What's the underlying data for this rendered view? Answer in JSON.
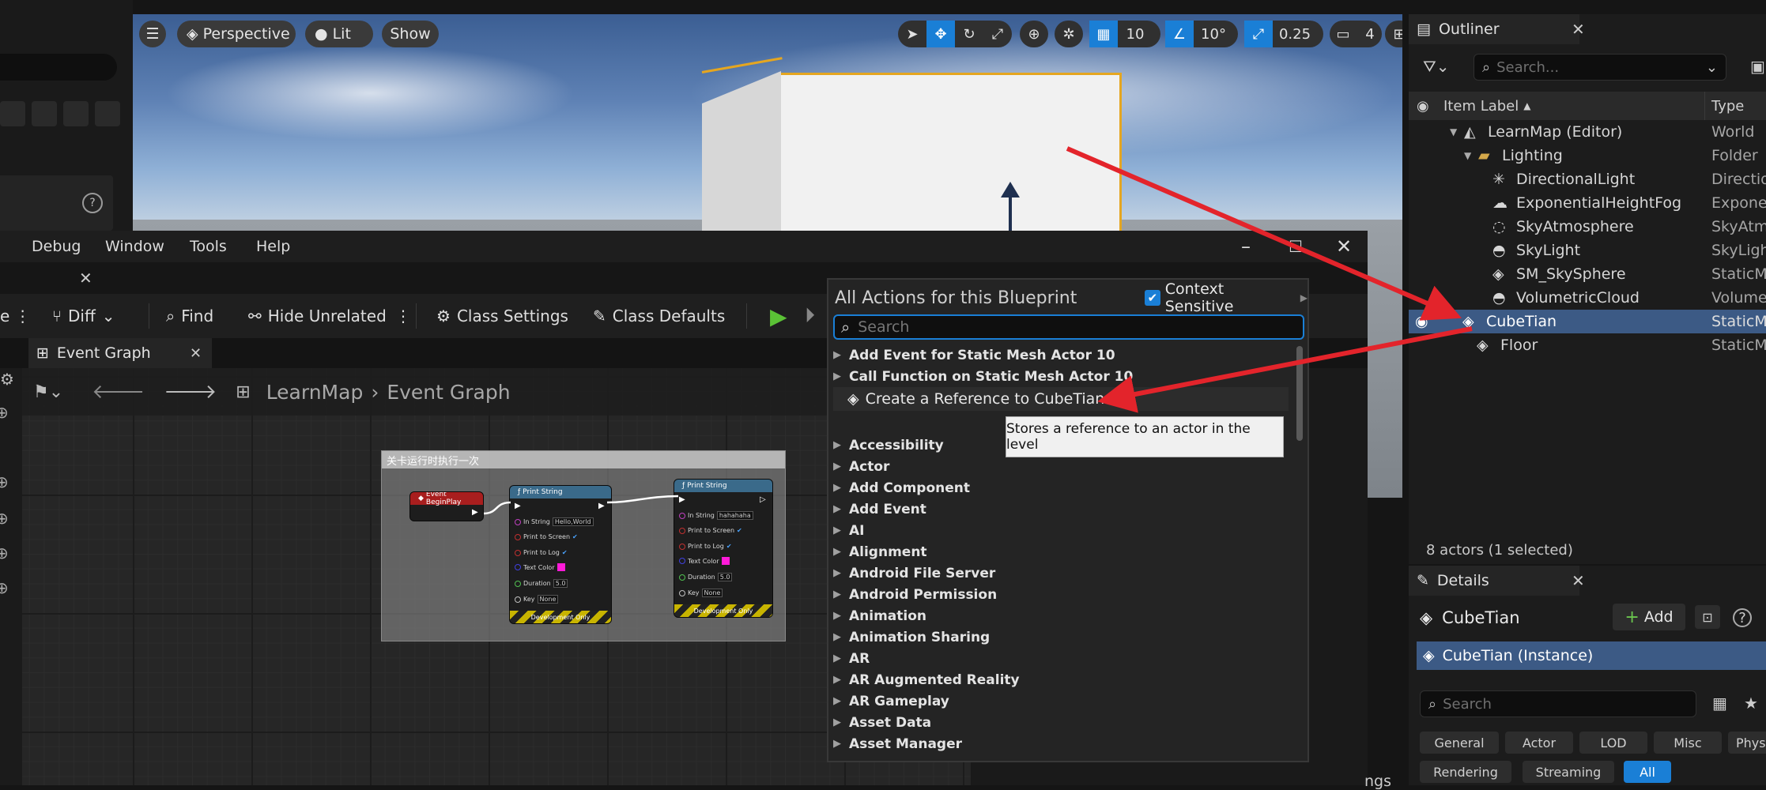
{
  "viewport": {
    "perspective_label": "Perspective",
    "lit_label": "Lit",
    "show_label": "Show",
    "grid_snap": "10",
    "rotation_snap": "10°",
    "scale_snap": "0.25",
    "camera_speed": "4"
  },
  "outliner": {
    "title": "Outliner",
    "search_placeholder": "Search...",
    "col_label": "Item Label",
    "col_type": "Type",
    "rows": [
      {
        "label": "LearnMap (Editor)",
        "type": "World"
      },
      {
        "label": "Lighting",
        "type": "Folder"
      },
      {
        "label": "DirectionalLight",
        "type": "DirectionalLight"
      },
      {
        "label": "ExponentialHeightFog",
        "type": "ExponentialHeightFog"
      },
      {
        "label": "SkyAtmosphere",
        "type": "SkyAtmosphere"
      },
      {
        "label": "SkyLight",
        "type": "SkyLight"
      },
      {
        "label": "SM_SkySphere",
        "type": "StaticMeshActor"
      },
      {
        "label": "VolumetricCloud",
        "type": "VolumetricCloud"
      },
      {
        "label": "CubeTian",
        "type": "StaticMeshActor"
      },
      {
        "label": "Floor",
        "type": "StaticMeshActor"
      }
    ],
    "status": "8 actors (1 selected)"
  },
  "details": {
    "title": "Details",
    "actor_name": "CubeTian",
    "add_label": "Add",
    "instance_label": "CubeTian (Instance)",
    "search_placeholder": "Search",
    "categories": [
      "General",
      "Actor",
      "LOD",
      "Misc",
      "Physics",
      "Rendering",
      "Streaming",
      "All"
    ]
  },
  "blueprint": {
    "menu": [
      "Debug",
      "Window",
      "Tools",
      "Help"
    ],
    "toolbar": {
      "diff": "Diff",
      "find": "Find",
      "hide_unrelated": "Hide Unrelated",
      "class_settings": "Class Settings",
      "class_defaults": "Class Defaults"
    },
    "graph_tab": "Event Graph",
    "breadcrumb_root": "LearnMap",
    "breadcrumb_leaf": "Event Graph",
    "partial_label": "ngs",
    "comment_title": "关卡运行时执行一次",
    "begin_play": "Event BeginPlay",
    "print_string_title": "Print String",
    "print1": {
      "in_string": "Hello,World",
      "duration": "5.0",
      "key": "None"
    },
    "print2": {
      "in_string": "hahahaha",
      "duration": "5.0",
      "key": "None"
    },
    "pin_labels": {
      "in_string": "In String",
      "print_screen": "Print to Screen",
      "print_log": "Print to Log",
      "text_color": "Text Color",
      "duration": "Duration",
      "key": "Key"
    },
    "dev_only": "Development Only"
  },
  "actions": {
    "title": "All Actions for this Blueprint",
    "context_sensitive": "Context Sensitive",
    "search_placeholder": "Search",
    "top_items": [
      "Add Event for Static Mesh Actor 10",
      "Call Function on Static Mesh Actor 10"
    ],
    "create_ref": "Create a Reference to CubeTian",
    "tooltip": "Stores a reference to an actor in the level",
    "categories": [
      "Accessibility",
      "Actor",
      "Add Component",
      "Add Event",
      "AI",
      "Alignment",
      "Android File Server",
      "Android Permission",
      "Animation",
      "Animation Sharing",
      "AR",
      "AR Augmented Reality",
      "AR Gameplay",
      "Asset Data",
      "Asset Manager"
    ]
  },
  "colors": {
    "accent": "#1a7fd6",
    "selection": "#3c5a85",
    "annotation_arrow": "#e3242b",
    "cube_outline": "#e5a620"
  }
}
